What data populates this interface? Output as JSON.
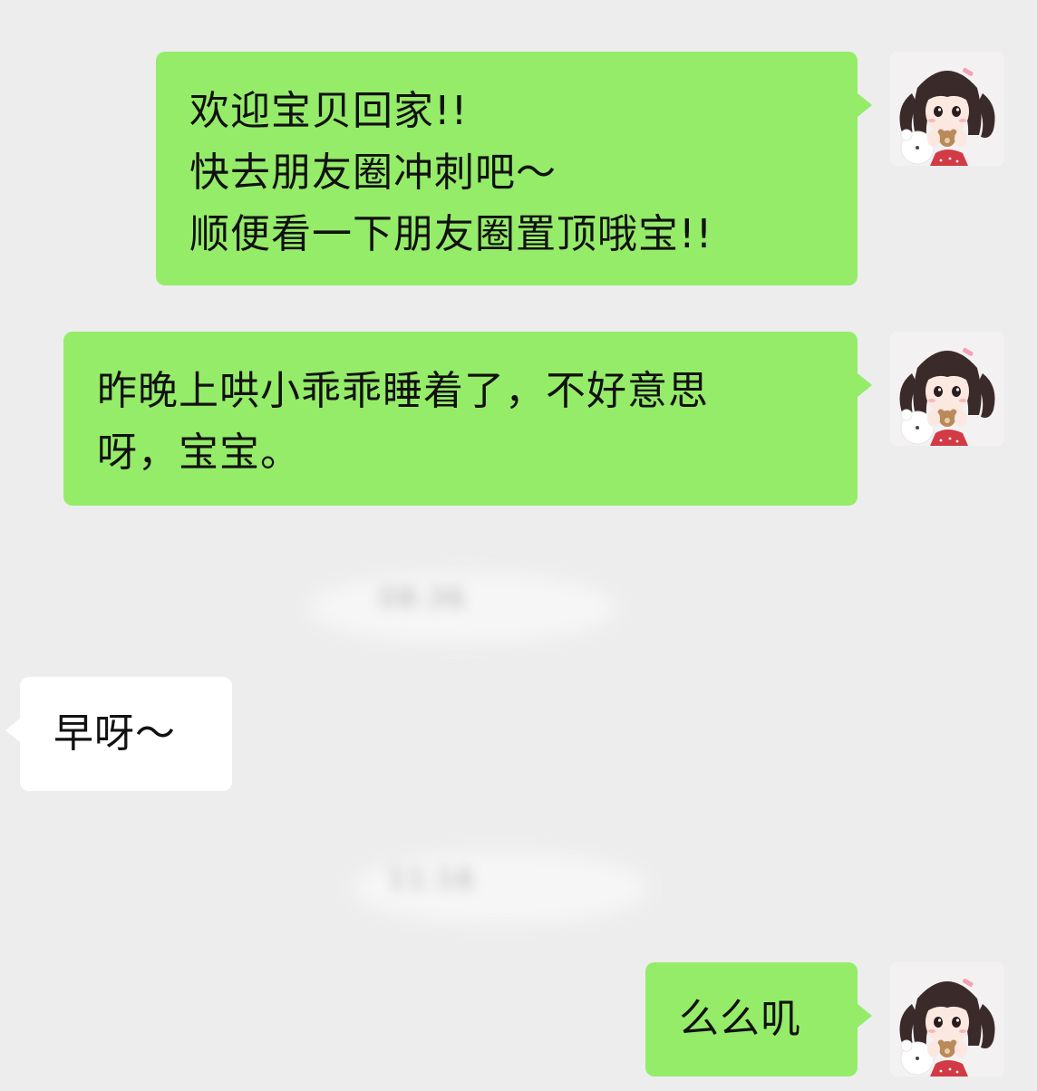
{
  "messages": [
    {
      "side": "right",
      "lines": [
        "欢迎宝贝回家!!",
        "快去朋友圈冲刺吧～",
        "顺便看一下朋友圈置顶哦宝!!"
      ],
      "avatar": "girl-with-bear-avatar"
    },
    {
      "side": "right",
      "lines": [
        "昨晚上哄小乖乖睡着了，不好意思",
        "呀，宝宝。"
      ],
      "avatar": "girl-with-bear-avatar"
    },
    {
      "type": "timestamp",
      "text": "08:36"
    },
    {
      "side": "left",
      "lines": [
        "早呀～"
      ]
    },
    {
      "type": "timestamp",
      "text": "11:16"
    },
    {
      "side": "right",
      "lines": [
        "么么叽"
      ],
      "avatar": "girl-with-bear-avatar"
    }
  ],
  "colors": {
    "background": "#ededed",
    "outgoing_bubble": "#95ec69",
    "incoming_bubble": "#ffffff"
  }
}
